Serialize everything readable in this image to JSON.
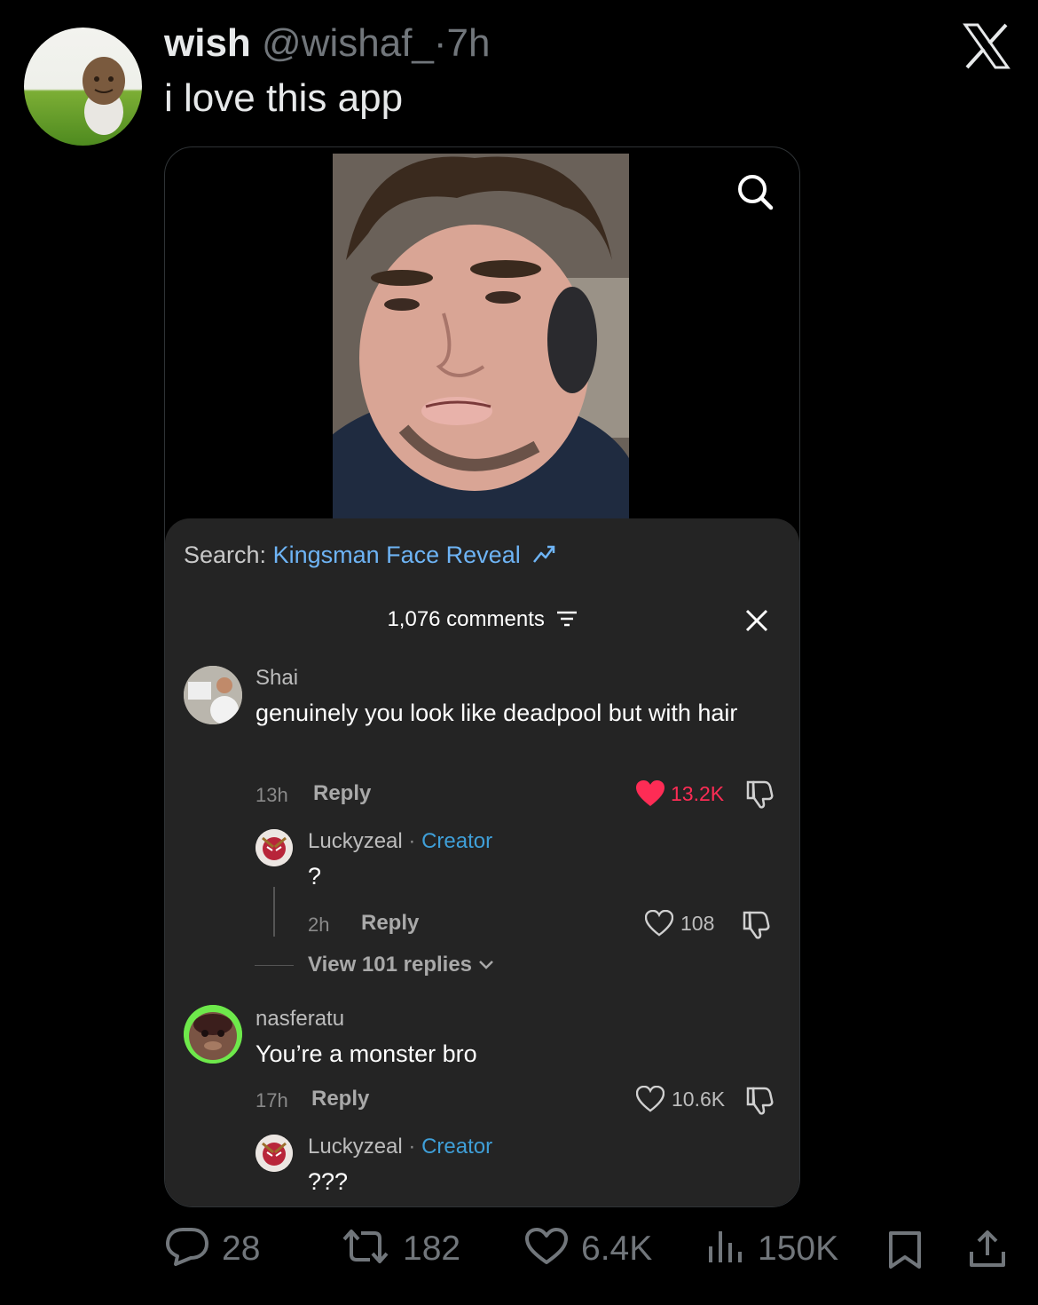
{
  "tweet": {
    "author_name": "wish",
    "handle": "@wishaf_",
    "separator": "·",
    "time": "7h",
    "text": "i love this app"
  },
  "video_overlay": {
    "search_prefix": "Search:",
    "search_query": "Kingsman Face Reveal",
    "comments_label": "1,076 comments",
    "comments": [
      {
        "user": "Shai",
        "text": "genuinely you look like deadpool but with hair",
        "time": "13h",
        "reply_label": "Reply",
        "likes": "13.2K",
        "liked": true
      },
      {
        "user": "Luckyzeal",
        "separator": "·",
        "badge": "Creator",
        "text": "?",
        "time": "2h",
        "reply_label": "Reply",
        "likes": "108"
      },
      {
        "view_replies": "View 101 replies"
      },
      {
        "user": "nasferatu",
        "text": "You’re a monster bro",
        "time": "17h",
        "reply_label": "Reply",
        "likes": "10.6K"
      },
      {
        "user": "Luckyzeal",
        "separator": "·",
        "badge": "Creator",
        "text": "???"
      }
    ]
  },
  "actions": {
    "replies": "28",
    "reposts": "182",
    "likes": "6.4K",
    "views": "150K"
  },
  "colors": {
    "background": "#000000",
    "sheet": "#242424",
    "link_blue": "#6eb4f5",
    "creator_blue": "#3f9fd8",
    "liked_red": "#fe2c55",
    "muted": "#71767b"
  },
  "icons": [
    "x-logo-icon",
    "search-icon",
    "trending-icon",
    "filter-icon",
    "close-icon",
    "heart-icon",
    "dislike-icon",
    "chevron-down-icon",
    "reply-bubble-icon",
    "repost-icon",
    "views-icon",
    "bookmark-icon",
    "share-icon"
  ]
}
